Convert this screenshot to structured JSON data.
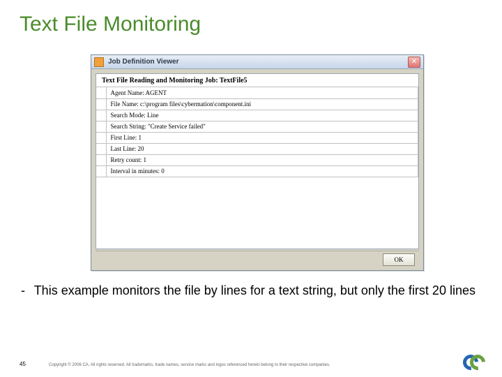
{
  "slide": {
    "title": "Text File Monitoring",
    "caption_dash": "-",
    "caption": "This example monitors the file by lines for a text string, but only the first 20 lines",
    "page_number": "45",
    "copyright": "Copyright © 2006 CA. All rights reserved. All trademarks, trade names, service marks and logos referenced herein belong to their respective companies."
  },
  "window": {
    "title": "Job Definition Viewer",
    "close_label": "✕",
    "job_header": "Text File Reading and Monitoring Job: TextFile5",
    "rows": [
      "Agent Name: AGENT",
      "File Name: c:\\program files\\cybermation\\component.ini",
      "Search Mode: Line",
      "Search String: \"Create Service failed\"",
      "First Line: 1",
      "Last Line: 20",
      "Retry count: 1",
      "Interval in minutes: 0"
    ],
    "ok_label": "OK"
  }
}
